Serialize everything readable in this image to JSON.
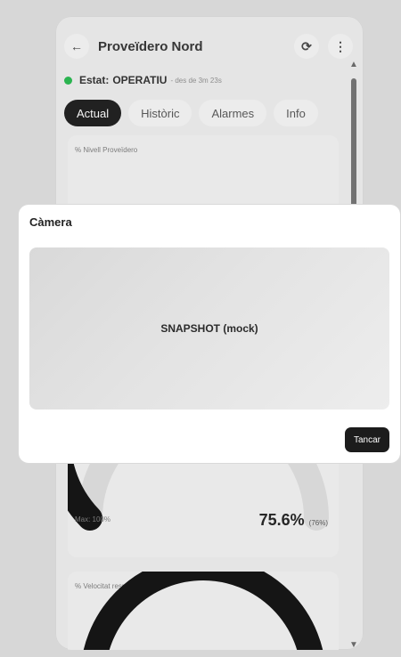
{
  "header": {
    "title": "Proveïdero Nord",
    "back_icon": "←",
    "refresh_icon": "⟳",
    "menu_icon": "⋮"
  },
  "status": {
    "label": "Estat:",
    "value": "OPERATIU",
    "since": "- des de 3m 23s",
    "color": "#27b34d"
  },
  "tabs": [
    {
      "label": "Actual",
      "active": true
    },
    {
      "label": "Històric",
      "active": false
    },
    {
      "label": "Alarmes",
      "active": false
    },
    {
      "label": "Info",
      "active": false
    }
  ],
  "top_card": {
    "label": "% Nivell Proveïdero",
    "max_text": "Max: 100%",
    "value_text": "75.6%",
    "value_small": "(76%)",
    "gauge_value_percent": 75.6
  },
  "bottom_card": {
    "label": "% Velocitat respecte màxim"
  },
  "modal": {
    "title": "Càmera",
    "snapshot_text": "SNAPSHOT (mock)",
    "close_label": "Tancar"
  }
}
